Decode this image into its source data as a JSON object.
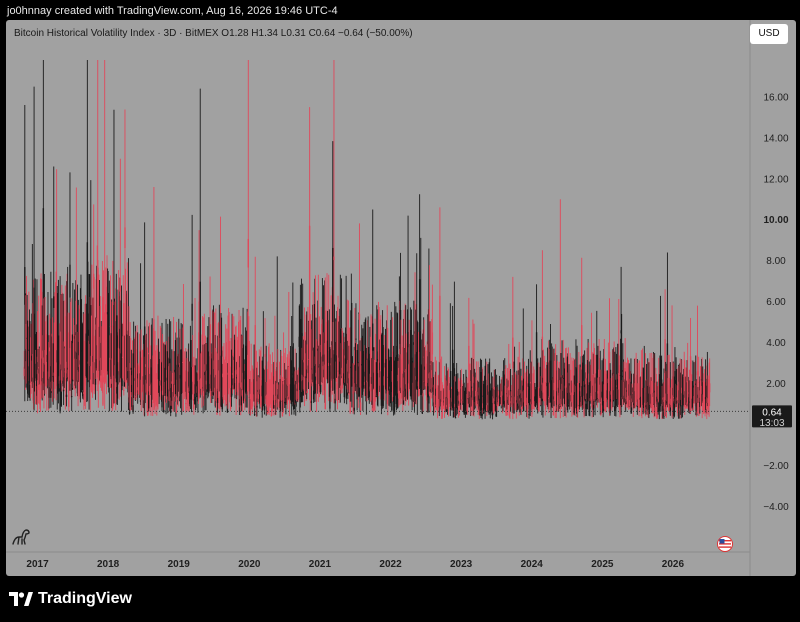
{
  "header": {
    "credit": "jo0hnnay created with TradingView.com, Aug 16, 2026 19:46 UTC-4"
  },
  "legend": {
    "text": "Bitcoin Historical Volatility Index · 3D · BitMEX  O1.28  H1.34  L0.31  C0.64  −0.64 (−50.00%)"
  },
  "currency_button": "USD",
  "price_badge": {
    "value": "0.64",
    "countdown": "13:03"
  },
  "footer": {
    "brand": "TradingView"
  },
  "colors": {
    "plot_background": "#a1a1a1",
    "up_candle": "#e0485a",
    "down_candle": "#1a1a1a",
    "badge_background": "#1a1a1a"
  },
  "icons": [
    "dinosaur-icon",
    "us-flag-icon",
    "tradingview-logo-icon"
  ],
  "chart_data": {
    "type": "candlestick",
    "title": "Bitcoin Historical Volatility Index · 3D · BitMEX",
    "xlabel": "",
    "ylabel": "",
    "ylim": [
      -5.4,
      17.8
    ],
    "y_ticks": [
      {
        "value": 16,
        "label": "16.00",
        "bold": false
      },
      {
        "value": 14,
        "label": "14.00",
        "bold": false
      },
      {
        "value": 12,
        "label": "12.00",
        "bold": false
      },
      {
        "value": 10,
        "label": "10.00",
        "bold": true
      },
      {
        "value": 8,
        "label": "8.00",
        "bold": false
      },
      {
        "value": 6,
        "label": "6.00",
        "bold": false
      },
      {
        "value": 4,
        "label": "4.00",
        "bold": false
      },
      {
        "value": 2,
        "label": "2.00",
        "bold": false
      },
      {
        "value": -2,
        "label": "−2.00",
        "bold": false
      },
      {
        "value": -4,
        "label": "−4.00",
        "bold": false
      }
    ],
    "x_range": [
      2016.95,
      2026.95
    ],
    "x_ticks": [
      {
        "value": 2017,
        "label": "2017"
      },
      {
        "value": 2018,
        "label": "2018"
      },
      {
        "value": 2019,
        "label": "2019"
      },
      {
        "value": 2020,
        "label": "2020"
      },
      {
        "value": 2021,
        "label": "2021"
      },
      {
        "value": 2022,
        "label": "2022"
      },
      {
        "value": 2023,
        "label": "2023"
      },
      {
        "value": 2024,
        "label": "2024"
      },
      {
        "value": 2025,
        "label": "2025"
      },
      {
        "value": 2026,
        "label": "2026"
      }
    ],
    "last_value": 0.64,
    "peak_highs": [
      {
        "x": 2017.02,
        "y": 15.6
      },
      {
        "x": 2017.15,
        "y": 16.5
      },
      {
        "x": 2017.28,
        "y": 17.8
      },
      {
        "x": 2017.9,
        "y": 17.8
      },
      {
        "x": 2018.05,
        "y": 17.8
      },
      {
        "x": 2018.15,
        "y": 17.8
      },
      {
        "x": 2018.85,
        "y": 11.6
      },
      {
        "x": 2019.5,
        "y": 16.4
      },
      {
        "x": 2020.18,
        "y": 17.8
      },
      {
        "x": 2021.05,
        "y": 15.5
      },
      {
        "x": 2021.4,
        "y": 17.8
      },
      {
        "x": 2021.95,
        "y": 10.5
      },
      {
        "x": 2022.45,
        "y": 10.2
      },
      {
        "x": 2022.9,
        "y": 10.6
      },
      {
        "x": 2024.6,
        "y": 11.0
      },
      {
        "x": 2026.12,
        "y": 8.4
      },
      {
        "x": 2026.45,
        "y": 5.2
      }
    ],
    "segment_levels": [
      {
        "from": 2016.95,
        "to": 2017.9,
        "base": 3.6
      },
      {
        "from": 2017.9,
        "to": 2018.5,
        "base": 4.2
      },
      {
        "from": 2018.5,
        "to": 2019.5,
        "base": 2.5
      },
      {
        "from": 2019.5,
        "to": 2020.2,
        "base": 2.8
      },
      {
        "from": 2020.2,
        "to": 2020.9,
        "base": 1.9
      },
      {
        "from": 2020.9,
        "to": 2021.6,
        "base": 3.6
      },
      {
        "from": 2021.6,
        "to": 2022.8,
        "base": 2.9
      },
      {
        "from": 2022.8,
        "to": 2024.3,
        "base": 1.6
      },
      {
        "from": 2024.3,
        "to": 2025.5,
        "base": 2.0
      },
      {
        "from": 2025.5,
        "to": 2026.95,
        "base": 1.7
      }
    ]
  }
}
